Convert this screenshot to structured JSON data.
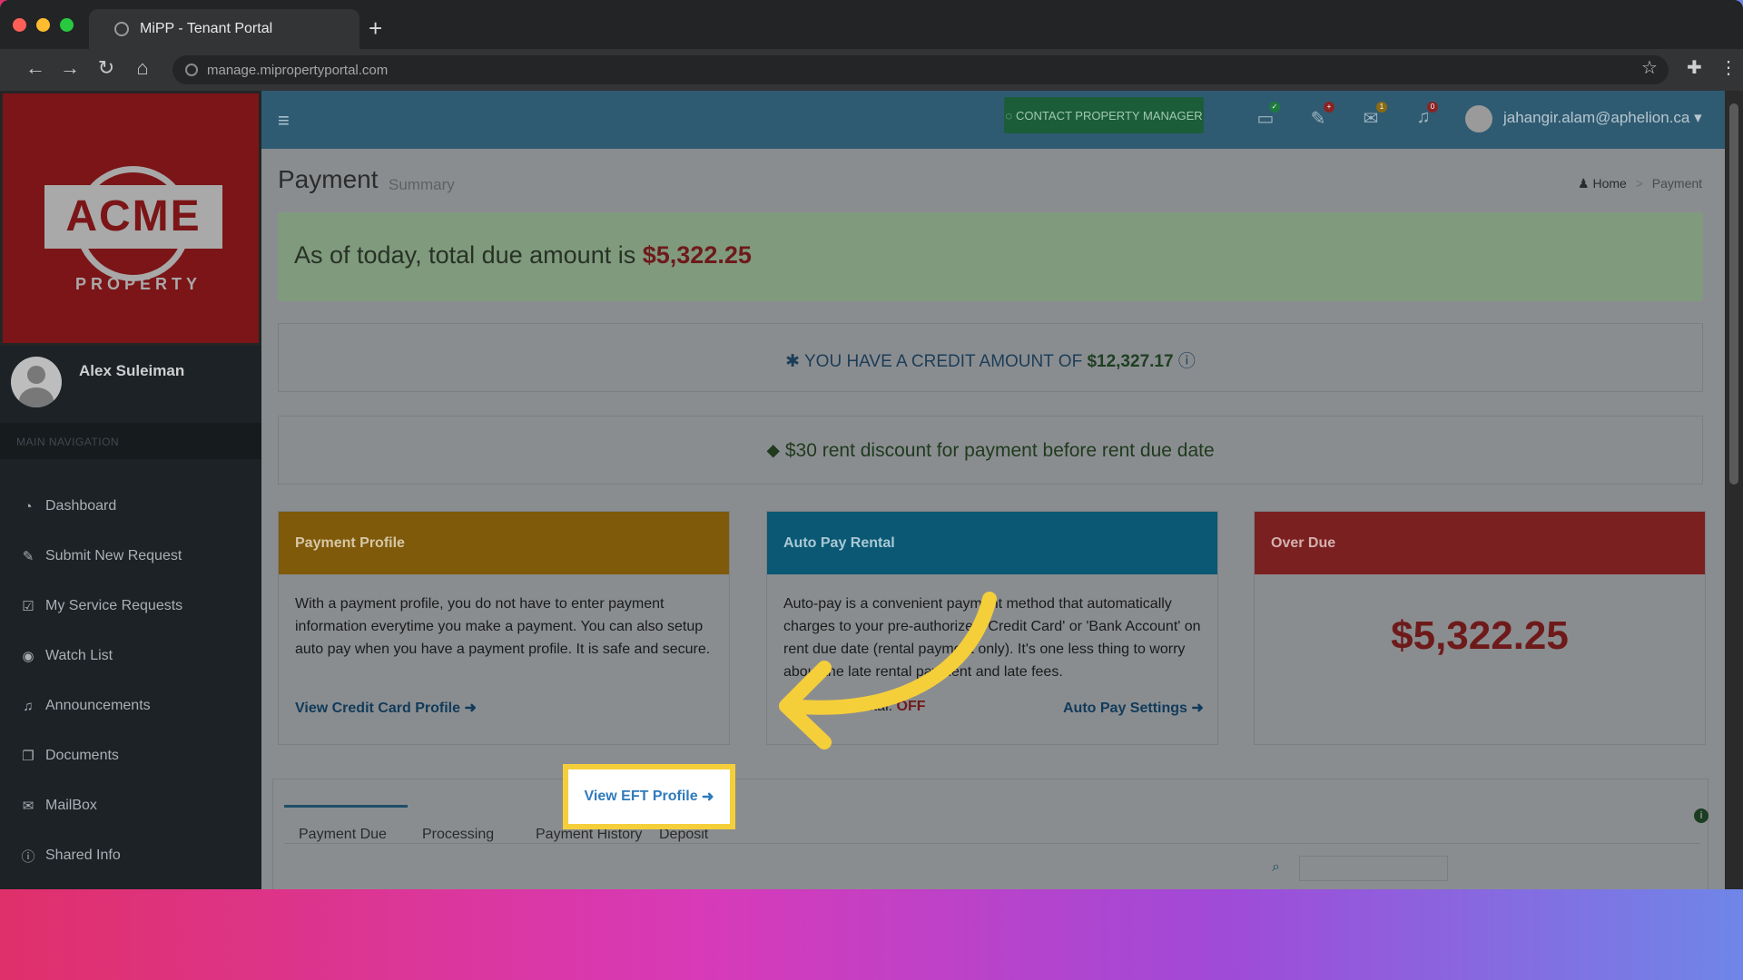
{
  "browser": {
    "tab_title": "MiPP - Tenant Portal",
    "new_tab": "+",
    "url": "manage.mipropertyportal.com"
  },
  "logo": {
    "name": "ACME",
    "sub": "PROPERTY"
  },
  "sidebar": {
    "user_name": "Alex Suleiman",
    "nav_header": "MAIN NAVIGATION",
    "items": [
      {
        "label": "Dashboard",
        "icon": "dashboard-icon",
        "glyph": "◔"
      },
      {
        "label": "Submit New Request",
        "icon": "wrench-icon",
        "glyph": "✎"
      },
      {
        "label": "My Service Requests",
        "icon": "checkbox-icon",
        "glyph": "☑"
      },
      {
        "label": "Watch List",
        "icon": "eye-icon",
        "glyph": "◉"
      },
      {
        "label": "Announcements",
        "icon": "bell-icon",
        "glyph": "♫"
      },
      {
        "label": "Documents",
        "icon": "documents-icon",
        "glyph": "❐"
      },
      {
        "label": "MailBox",
        "icon": "mail-icon",
        "glyph": "✉"
      },
      {
        "label": "Shared Info",
        "icon": "info-icon",
        "glyph": "ⓘ"
      }
    ]
  },
  "header": {
    "contact_button": "CONTACT PROPERTY MANAGER",
    "badges": {
      "mail": "1",
      "bell": "0"
    },
    "user_email": "jahangir.alam@aphelion.ca"
  },
  "page": {
    "title": "Payment",
    "subtitle": "Summary",
    "breadcrumb": {
      "home": "Home",
      "current": "Payment"
    }
  },
  "due": {
    "prefix": "As of today, total due amount is",
    "amount": "$5,322.25"
  },
  "credit": {
    "prefix": "YOU HAVE A CREDIT AMOUNT OF",
    "amount": "$12,327.17"
  },
  "discount": {
    "text": "$30 rent discount for payment before rent due date"
  },
  "cards": {
    "payment_profile": {
      "title": "Payment Profile",
      "body": "With a payment profile, you do not have to enter payment information everytime you make a payment. You can also setup auto pay when you have a payment profile. It is safe and secure.",
      "link_credit": "View Credit Card Profile",
      "link_eft": "View EFT Profile"
    },
    "auto_pay": {
      "title": "Auto Pay Rental",
      "body": "Auto-pay is a convenient payment method that automatically charges to your pre-authorized 'Credit Card' or 'Bank Account' on rent due date (rental payment only). It's one less thing to worry about the late rental payment and late fees.",
      "status_label": "Auto Pay Rental:",
      "status_value": "OFF",
      "settings_link": "Auto Pay Settings"
    },
    "over_due": {
      "title": "Over Due",
      "amount": "$5,322.25"
    }
  },
  "tabs": [
    "Payment Due",
    "Processing",
    "Payment History",
    "Deposit"
  ],
  "colors": {
    "accent_yellow": "#f5cf3a",
    "profile_header": "#7f5a0a",
    "autopay_header": "#0a5874",
    "overdue_header": "#7b2020"
  }
}
